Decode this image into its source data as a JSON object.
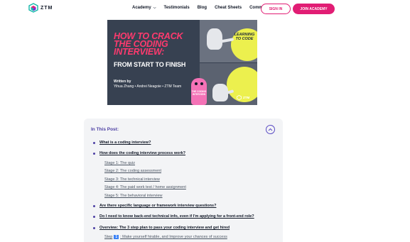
{
  "header": {
    "logo_text": "ZTM",
    "nav": [
      {
        "label": "Academy",
        "has_dropdown": true
      },
      {
        "label": "Testimonials"
      },
      {
        "label": "Blog"
      },
      {
        "label": "Cheat Sheets"
      },
      {
        "label": "Community"
      }
    ],
    "signin_label": "SIGN IN",
    "join_label": "JOIN ACADEMY",
    "accent_color": "#e11d74"
  },
  "hero": {
    "title": "HOW TO CRACK\nTHE CODING\nINTERVIEW:",
    "subtitle": "FROM START TO FINISH",
    "written_by": "Written by",
    "authors": "Yihua Zhang • Andrei Neagoie • ZTM Team",
    "sun_text": "LEARNING TO CODE",
    "pink_text": "THE CODING INTERVIEW",
    "badge_text": "ZTM"
  },
  "toc": {
    "title": "In This Post:",
    "items": [
      {
        "label": "What is a coding interview?"
      },
      {
        "label": "How does the coding interview process work?"
      },
      {
        "label": "Are there specific language or framework interview questions?"
      },
      {
        "label": "Do I need to know back-end technical info, even if I'm applying for a front-end role?"
      },
      {
        "label": "Overview: The 3 step plan to pass your coding interview and get hired"
      }
    ],
    "subitems": [
      "Stage 1: The quiz",
      "Stage 2: The coding assessment",
      "Stage 3: The technical interview",
      "Stage 4: The paid work test / home assignment",
      "Stage 5: The behavioral interview"
    ],
    "step": {
      "prefix": "Step",
      "number": "1",
      "text": ": Make yourself hirable, and Improve your chances of success"
    }
  }
}
